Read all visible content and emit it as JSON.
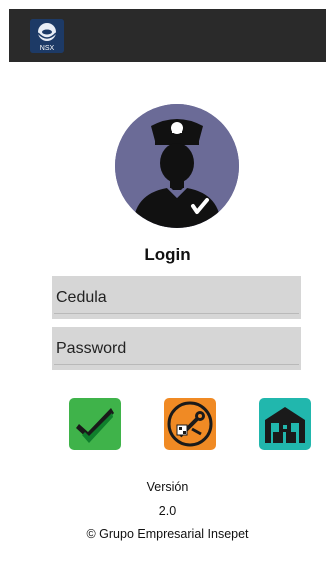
{
  "login": {
    "title": "Login",
    "cedula_placeholder": "Cedula",
    "password_placeholder": "Password"
  },
  "actions": [
    {
      "icon": "checkmark-icon",
      "color": "#3fb34a"
    },
    {
      "icon": "tools-settings-icon",
      "color": "#f08a24"
    },
    {
      "icon": "warehouse-icon",
      "color": "#21b7ad"
    }
  ],
  "footer": {
    "version_label": "Versión",
    "version_value": "2.0",
    "copyright": "© Grupo Empresarial Insepet"
  },
  "colors": {
    "app_bar": "#2a2a2a",
    "avatar_bg": "#6b6b97",
    "field_bg": "#d6d6d6"
  }
}
